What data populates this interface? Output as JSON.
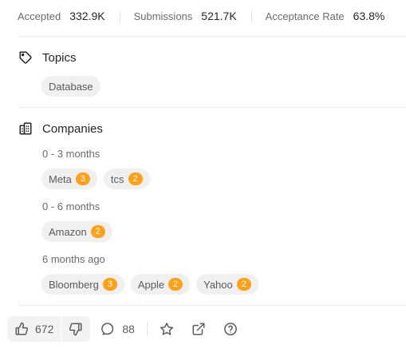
{
  "stats": {
    "accepted_label": "Accepted",
    "accepted_value": "332.9K",
    "submissions_label": "Submissions",
    "submissions_value": "521.7K",
    "acceptance_label": "Acceptance Rate",
    "acceptance_value": "63.8%"
  },
  "topics": {
    "title": "Topics",
    "icon": "tag-icon",
    "tags": [
      "Database"
    ]
  },
  "companies": {
    "title": "Companies",
    "icon": "building-icon",
    "badge_color": "#ffa116",
    "groups": [
      {
        "label": "0 - 3 months",
        "items": [
          {
            "name": "Meta",
            "count": "3"
          },
          {
            "name": "tcs",
            "count": "2"
          }
        ]
      },
      {
        "label": "0 - 6 months",
        "items": [
          {
            "name": "Amazon",
            "count": "2"
          }
        ]
      },
      {
        "label": "6 months ago",
        "items": [
          {
            "name": "Bloomberg",
            "count": "3"
          },
          {
            "name": "Apple",
            "count": "2"
          },
          {
            "name": "Yahoo",
            "count": "2"
          }
        ]
      }
    ]
  },
  "footer": {
    "upvotes": "672",
    "comments": "88",
    "icons": [
      "thumbs-up-icon",
      "thumbs-down-icon",
      "comment-icon",
      "star-icon",
      "share-icon",
      "help-icon"
    ]
  }
}
